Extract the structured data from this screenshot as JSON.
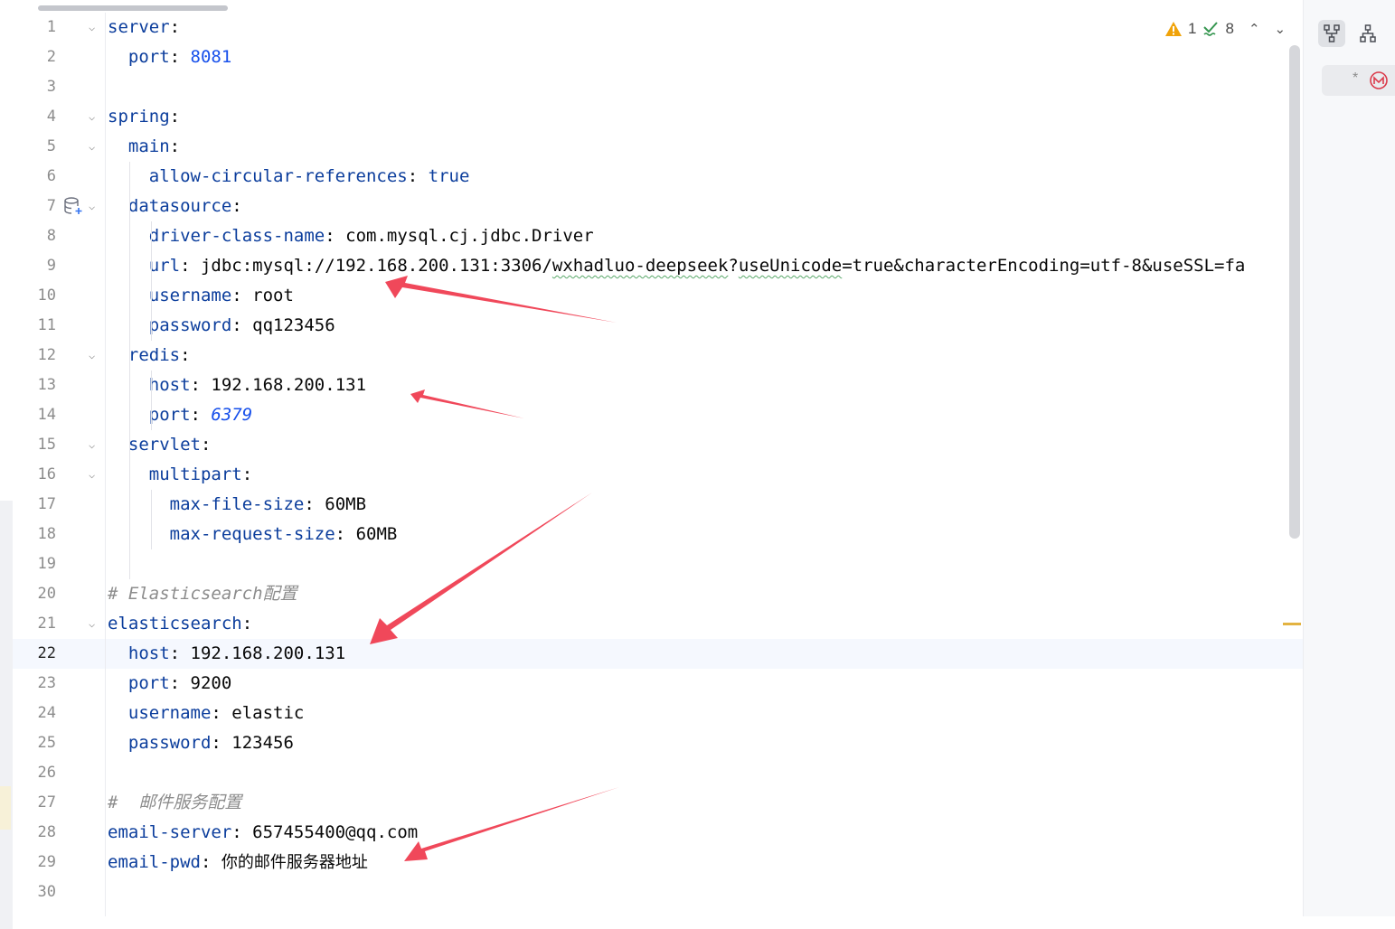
{
  "status": {
    "warnings": "1",
    "checks": "8"
  },
  "lines": [
    {
      "n": "1"
    },
    {
      "n": "2"
    },
    {
      "n": "3"
    },
    {
      "n": "4"
    },
    {
      "n": "5"
    },
    {
      "n": "6"
    },
    {
      "n": "7"
    },
    {
      "n": "8"
    },
    {
      "n": "9"
    },
    {
      "n": "10"
    },
    {
      "n": "11"
    },
    {
      "n": "12"
    },
    {
      "n": "13"
    },
    {
      "n": "14"
    },
    {
      "n": "15"
    },
    {
      "n": "16"
    },
    {
      "n": "17"
    },
    {
      "n": "18"
    },
    {
      "n": "19"
    },
    {
      "n": "20"
    },
    {
      "n": "21"
    },
    {
      "n": "22"
    },
    {
      "n": "23"
    },
    {
      "n": "24"
    },
    {
      "n": "25"
    },
    {
      "n": "26"
    },
    {
      "n": "27"
    },
    {
      "n": "28"
    },
    {
      "n": "29"
    },
    {
      "n": "30"
    }
  ],
  "code": {
    "server": "server",
    "server_port_key": "port",
    "server_port": "8081",
    "spring": "spring",
    "main": "main",
    "allow_key": "allow-circular-references",
    "allow_val": "true",
    "datasource": "datasource",
    "driver_key": "driver-class-name",
    "driver_val": "com.mysql.cj.jdbc.Driver",
    "url_key": "url",
    "url_prefix": "jdbc:mysql://192.168.200.131:3306/",
    "url_db": "wxhadluo-deepseek",
    "url_q": "?",
    "url_param1": "useUnicode",
    "url_rest": "=true&characterEncoding=utf-8&useSSL=fa",
    "ds_user_key": "username",
    "ds_user_val": "root",
    "ds_pass_key": "password",
    "ds_pass_val": "qq123456",
    "redis": "redis",
    "redis_host_key": "host",
    "redis_host_val": "192.168.200.131",
    "redis_port_key": "port",
    "redis_port_val": "6379",
    "servlet": "servlet",
    "multipart": "multipart",
    "mfs_key": "max-file-size",
    "mfs_val": "60MB",
    "mrs_key": "max-request-size",
    "mrs_val": "60MB",
    "es_comment": "# Elasticsearch配置",
    "es": "elasticsearch",
    "es_host_key": "host",
    "es_host_val": "192.168.200.131",
    "es_port_key": "port",
    "es_port_val": "9200",
    "es_user_key": "username",
    "es_user_val": "elastic",
    "es_pass_key": "password",
    "es_pass_val": "123456",
    "mail_comment": "#  邮件服务配置",
    "mail_server_key": "email-server",
    "mail_server_val": "657455400@qq.com",
    "mail_pwd_key": "email-pwd",
    "mail_pwd_val": "你的邮件服务器地址"
  },
  "right_panel": {
    "tab_star": "*"
  },
  "colors": {
    "annotation_arrow": "#f0485a",
    "key": "#0b3d9c",
    "number": "#1750eb",
    "comment": "#8c8c8c"
  },
  "icons": [
    "warning-icon",
    "check-icon",
    "chevron-up-icon",
    "chevron-down-icon",
    "database-icon",
    "structure-icon",
    "hierarchy-icon",
    "maven-icon",
    "fold-icon"
  ]
}
